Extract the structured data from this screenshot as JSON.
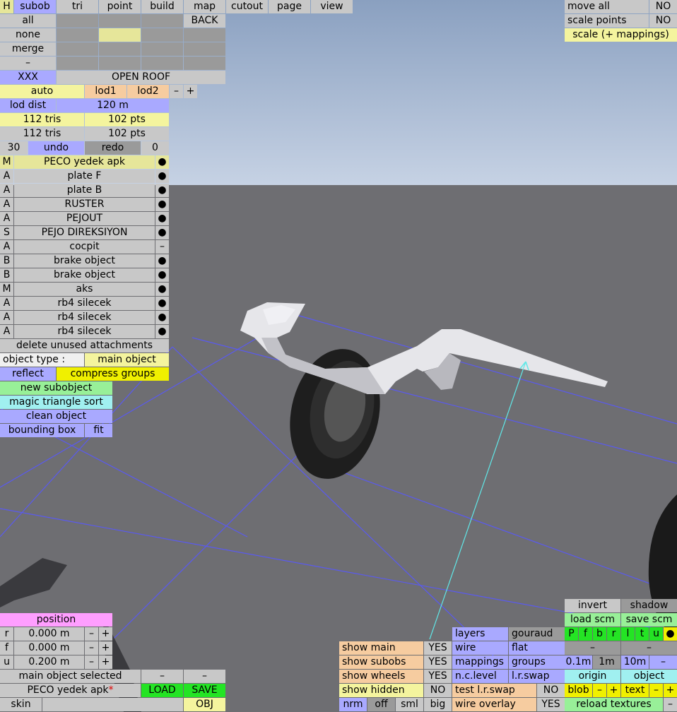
{
  "colors": {
    "sky_top": "#8ea0be",
    "sky_bottom": "#c4d0e2",
    "ground": "#6e6e72",
    "grid_line": "#5a5af0",
    "cyan_line": "#60e8e8"
  },
  "toolbar": {
    "h": "H",
    "tabs": [
      "subob",
      "tri",
      "point",
      "build",
      "map",
      "cutout",
      "page",
      "view"
    ]
  },
  "sel_rows": {
    "all": "all",
    "back": "BACK",
    "none": "none",
    "merge": "merge",
    "dash": "–",
    "xxx": "XXX",
    "open_roof": "OPEN ROOF"
  },
  "lod": {
    "auto": "auto",
    "lod1": "lod1",
    "lod2": "lod2",
    "minus": "–",
    "plus": "+",
    "lod_dist_label": "lod dist",
    "lod_dist_value": "120 m",
    "tris1": "112 tris",
    "pts1": "102 pts",
    "tris2": "112 tris",
    "pts2": "102 pts"
  },
  "undo": {
    "count": "30",
    "undo": "undo",
    "redo": "redo",
    "redo_count": "0"
  },
  "subobjects": [
    {
      "flag": "M",
      "name": "PECO yedek apk",
      "mark": "●",
      "selected": true
    },
    {
      "flag": "A",
      "name": "plate F",
      "mark": "●"
    },
    {
      "flag": "A",
      "name": "plate B",
      "mark": "●"
    },
    {
      "flag": "A",
      "name": "RUSTER",
      "mark": "●"
    },
    {
      "flag": "A",
      "name": "PEJOUT",
      "mark": "●"
    },
    {
      "flag": "S",
      "name": "PEJO DIREKSIYON",
      "mark": "●"
    },
    {
      "flag": "A",
      "name": "cocpit",
      "mark": "–"
    },
    {
      "flag": "B",
      "name": "brake object",
      "mark": "●"
    },
    {
      "flag": "B",
      "name": "brake object",
      "mark": "●"
    },
    {
      "flag": "M",
      "name": "aks",
      "mark": "●"
    },
    {
      "flag": "A",
      "name": "rb4 silecek",
      "mark": "●"
    },
    {
      "flag": "A",
      "name": "rb4 silecek",
      "mark": "●"
    },
    {
      "flag": "A",
      "name": "rb4 silecek",
      "mark": "●"
    }
  ],
  "obj_actions": {
    "delete_unused": "delete unused attachments",
    "object_type_label": "object type :",
    "object_type_value": "main object",
    "reflect": "reflect",
    "compress_groups": "compress groups",
    "new_subobject": "new subobject",
    "magic_sort": "magic triangle sort",
    "clean_object": "clean object",
    "bounding_box": "bounding box",
    "fit": "fit"
  },
  "top_right": {
    "move_all": "move all",
    "move_all_val": "NO",
    "scale_points": "scale points",
    "scale_points_val": "NO",
    "scale_mappings": "scale (+ mappings)"
  },
  "position": {
    "title": "position",
    "rows": [
      {
        "axis": "r",
        "value": "0.000 m"
      },
      {
        "axis": "f",
        "value": "0.000 m"
      },
      {
        "axis": "u",
        "value": "0.200 m"
      }
    ],
    "minus": "–",
    "plus": "+"
  },
  "bottom_left": {
    "main_selected": "main object selected",
    "dash": "–",
    "file_name": "PECO yedek apk",
    "file_star": "*",
    "load": "LOAD",
    "save": "SAVE",
    "skin": "skin",
    "obj": "OBJ"
  },
  "show": {
    "rows": [
      {
        "label": "show main",
        "val": "YES"
      },
      {
        "label": "show subobs",
        "val": "YES"
      },
      {
        "label": "show wheels",
        "val": "YES"
      },
      {
        "label": "show hidden",
        "val": "NO"
      }
    ],
    "sizes": [
      "nrm",
      "off",
      "sml",
      "big"
    ]
  },
  "render": {
    "layers": "layers",
    "gouraud": "gouraud",
    "wire": "wire",
    "flat": "flat",
    "mappings": "mappings",
    "groups": "groups",
    "nc_level": "n.c.level",
    "lr_swap": "l.r.swap",
    "test_lr_swap": "test l.r.swap",
    "test_lr_val": "NO",
    "wire_overlay": "wire overlay",
    "wire_overlay_val": "YES"
  },
  "br": {
    "invert": "invert",
    "shadow": "shadow",
    "load_scm": "load scm",
    "save_scm": "save scm",
    "letters": [
      "P",
      "f",
      "b",
      "r",
      "l",
      "t",
      "u",
      "●"
    ],
    "dash": "–",
    "grid": [
      "0.1m",
      "1m",
      "10m",
      "–"
    ],
    "origin": "origin",
    "object": "object",
    "blob": "blob",
    "text": "text",
    "minus": "–",
    "plus": "+",
    "reload_textures": "reload textures"
  }
}
